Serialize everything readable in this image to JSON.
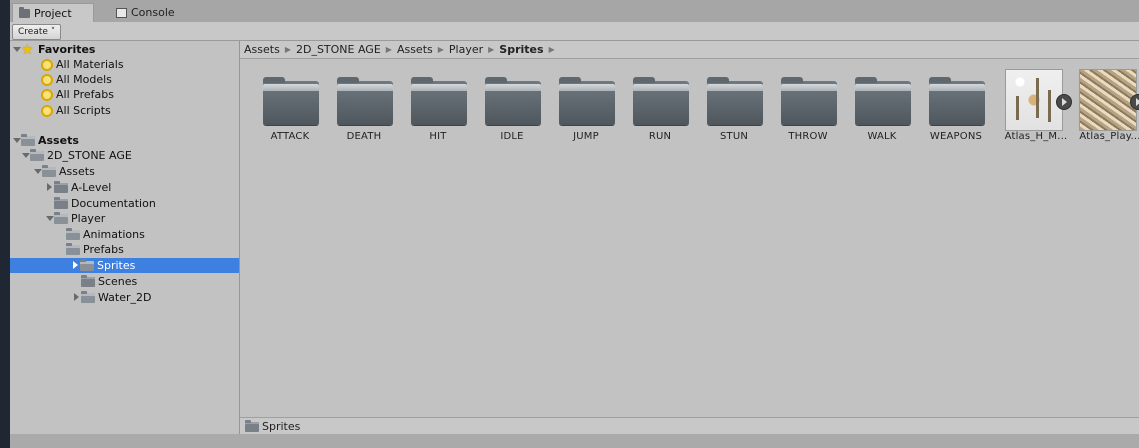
{
  "tabs": [
    {
      "label": "Project",
      "icon": "folder-icon"
    },
    {
      "label": "Console",
      "icon": "console-icon"
    }
  ],
  "toolbar": {
    "create_label": "Create ˅"
  },
  "tree": {
    "favorites": {
      "label": "Favorites",
      "items": [
        "All Materials",
        "All Models",
        "All Prefabs",
        "All Scripts"
      ]
    },
    "assets": {
      "label": "Assets",
      "nodes": [
        {
          "label": "2D_STONE AGE"
        },
        {
          "label": "Assets"
        },
        {
          "label": "A-Level"
        },
        {
          "label": "Documentation"
        },
        {
          "label": "Player"
        },
        {
          "label": "Animations"
        },
        {
          "label": "Prefabs"
        },
        {
          "label": "Sprites"
        },
        {
          "label": "Scenes"
        },
        {
          "label": "Water_2D"
        }
      ]
    }
  },
  "breadcrumb": [
    "Assets",
    "2D_STONE AGE",
    "Assets",
    "Player",
    "Sprites"
  ],
  "assets": [
    {
      "label": "ATTACK",
      "kind": "folder"
    },
    {
      "label": "DEATH",
      "kind": "folder"
    },
    {
      "label": "HIT",
      "kind": "folder"
    },
    {
      "label": "IDLE",
      "kind": "folder"
    },
    {
      "label": "JUMP",
      "kind": "folder"
    },
    {
      "label": "RUN",
      "kind": "folder"
    },
    {
      "label": "STUN",
      "kind": "folder"
    },
    {
      "label": "THROW",
      "kind": "folder"
    },
    {
      "label": "WALK",
      "kind": "folder"
    },
    {
      "label": "WEAPONS",
      "kind": "folder"
    },
    {
      "label": "Atlas_H_M...",
      "kind": "sprite-atlas"
    },
    {
      "label": "Atlas_Play...",
      "kind": "sprite-atlas"
    }
  ],
  "status": {
    "path_label": "Sprites"
  },
  "colors": {
    "selection": "#3d80df",
    "panel": "#c2c2c2",
    "tab_bar": "#a6a6a6"
  }
}
